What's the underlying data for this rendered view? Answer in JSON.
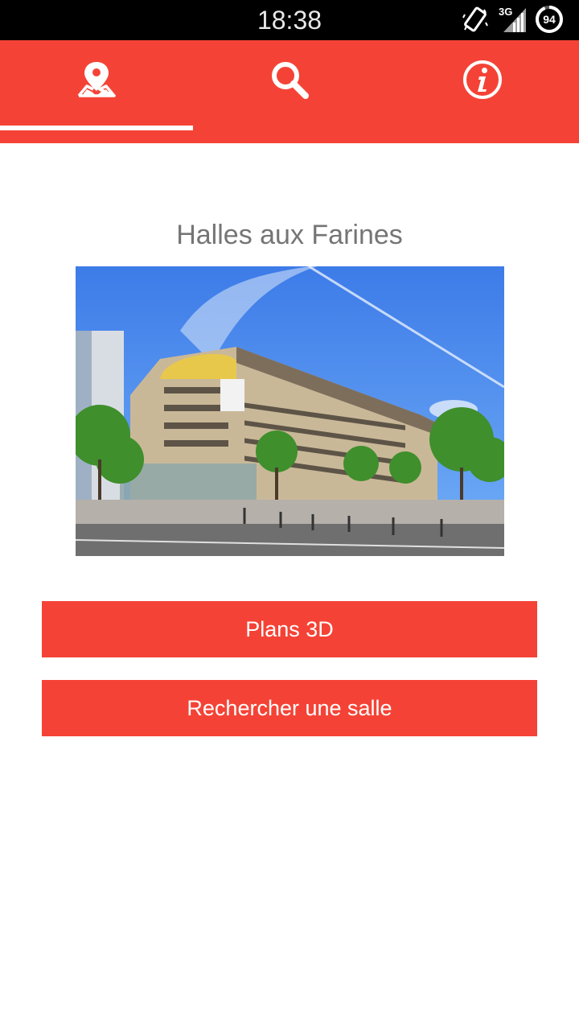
{
  "status_bar": {
    "time": "18:38",
    "network_type": "3G",
    "battery_level": "94",
    "icons": [
      "vibrate-icon",
      "signal-icon",
      "battery-icon"
    ]
  },
  "tabs": [
    {
      "name": "map",
      "icon": "map-pin-icon",
      "selected": true
    },
    {
      "name": "search",
      "icon": "search-icon",
      "selected": false
    },
    {
      "name": "info",
      "icon": "info-icon",
      "selected": false
    }
  ],
  "main": {
    "title": "Halles aux Farines",
    "photo": "building-photo",
    "buttons": {
      "plans_label": "Plans 3D",
      "search_room_label": "Rechercher une salle"
    }
  },
  "colors": {
    "accent": "#f44336",
    "status_bar": "#000000",
    "title_text": "#757575",
    "button_text": "#ffffff"
  }
}
